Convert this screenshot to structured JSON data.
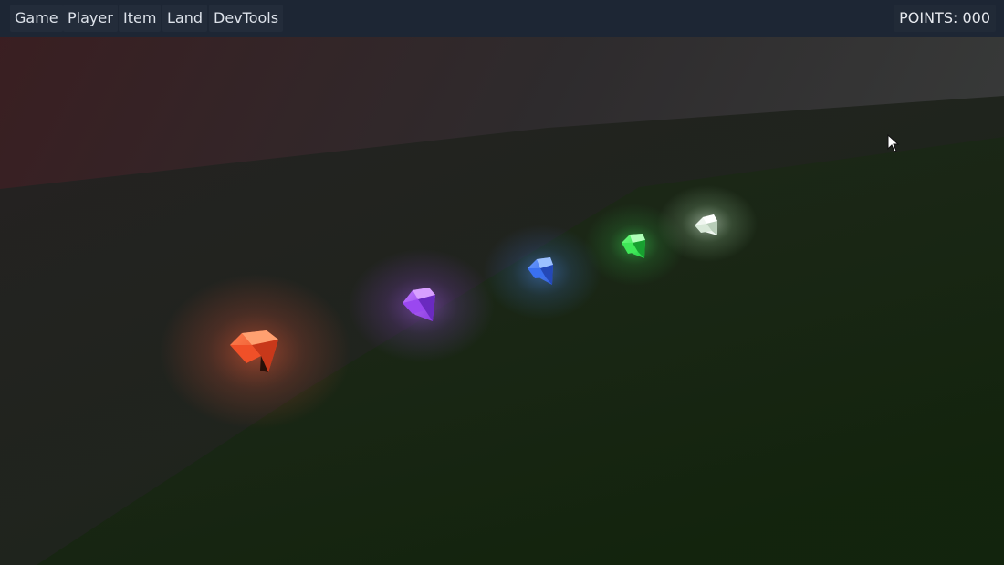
{
  "menu_bar": {
    "items": [
      {
        "label": "Game"
      },
      {
        "label": "Player"
      },
      {
        "label": "Item"
      },
      {
        "label": "Land"
      },
      {
        "label": "DevTools"
      }
    ]
  },
  "hud": {
    "points_label": "POINTS:",
    "points_value": "000"
  },
  "scene": {
    "sky_color": "#3b1e20",
    "ground_color": "#17230f",
    "gems": [
      {
        "name": "red-gem",
        "color": "#ff6a3a",
        "glow": "#ff5a30"
      },
      {
        "name": "purple-gem",
        "color": "#b05cff",
        "glow": "#a850ff"
      },
      {
        "name": "blue-gem",
        "color": "#4a80ff",
        "glow": "#4a88ff"
      },
      {
        "name": "green-gem",
        "color": "#40ff60",
        "glow": "#30e050"
      },
      {
        "name": "white-gem",
        "color": "#ffffff",
        "glow": "#e8ffe8"
      }
    ]
  }
}
